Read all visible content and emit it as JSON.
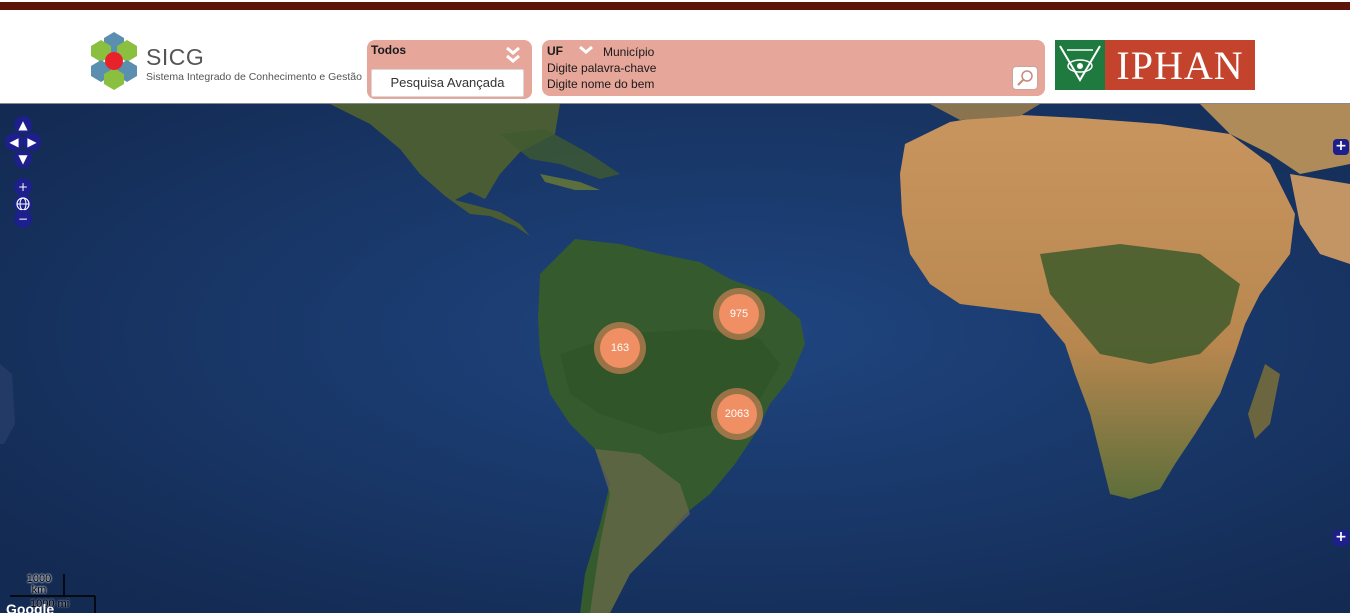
{
  "header": {
    "logo": {
      "name": "SICG",
      "subtitle": "Sistema Integrado de Conhecimento e Gestão"
    },
    "filter": {
      "selected": "Todos",
      "advanced_label": "Pesquisa Avançada"
    },
    "search": {
      "uf_label": "UF",
      "municipio_label": "Município",
      "keyword_placeholder": "Digite palavra-chave",
      "bem_placeholder": "Digite nome do bem"
    },
    "org_logo": {
      "text": "IPHAN"
    }
  },
  "map": {
    "controls": {
      "up": "▲",
      "left": "◀",
      "right": "▶",
      "down": "▼",
      "zoom_in": "+",
      "zoom_out": "−"
    },
    "clusters": [
      {
        "label": "975"
      },
      {
        "label": "163"
      },
      {
        "label": "2063"
      }
    ],
    "layer_toggle": "+",
    "overview_toggle": "+",
    "scale": {
      "km": "1000\nkm",
      "mi": "1000 mi"
    },
    "attribution": "Google"
  },
  "colors": {
    "header_stripe": "#5c1408",
    "panel": "#e6a69a",
    "cluster": "#ef8f63",
    "nav": "#1c1f8c"
  }
}
